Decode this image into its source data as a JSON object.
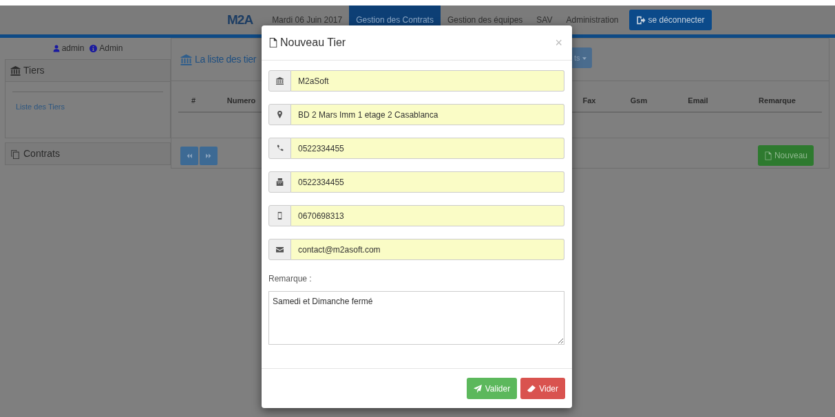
{
  "navbar": {
    "logo": "M2A",
    "date": "Mardi 06 Juin 2017",
    "items": [
      {
        "label": "Gestion des Contrats",
        "selected": true
      },
      {
        "label": "Gestion des équipes",
        "selected": false
      },
      {
        "label": "SAV",
        "selected": false
      },
      {
        "label": "Administration",
        "selected": false
      }
    ],
    "logout": "se déconnecter"
  },
  "sidebar": {
    "user": "admin",
    "role": "Admin",
    "sections": [
      {
        "title": "Tiers",
        "links": [
          "Liste des Tiers"
        ]
      },
      {
        "title": "Contrats"
      }
    ]
  },
  "main": {
    "title": "La liste des tier",
    "dropdown": "ts",
    "columns": [
      "#",
      "Numero",
      "Fax",
      "Gsm",
      "Email",
      "Remarque"
    ],
    "new_button": "Nouveau"
  },
  "modal": {
    "title": "Nouveau Tier",
    "close": "×",
    "fields": [
      {
        "kind": "name",
        "value": "M2aSoft"
      },
      {
        "kind": "address",
        "value": "BD 2 Mars Imm 1 etage 2 Casablanca"
      },
      {
        "kind": "phone",
        "value": "0522334455"
      },
      {
        "kind": "fax",
        "value": "0522334455"
      },
      {
        "kind": "mobile",
        "value": "0670698313"
      },
      {
        "kind": "email",
        "value": "contact@m2asoft.com"
      }
    ],
    "remark_label": "Remarque :",
    "remark": "Samedi et Dimanche fermé",
    "buttons": [
      {
        "kind": "submit",
        "label": "Valider"
      },
      {
        "kind": "reset",
        "label": "Vider"
      }
    ]
  }
}
